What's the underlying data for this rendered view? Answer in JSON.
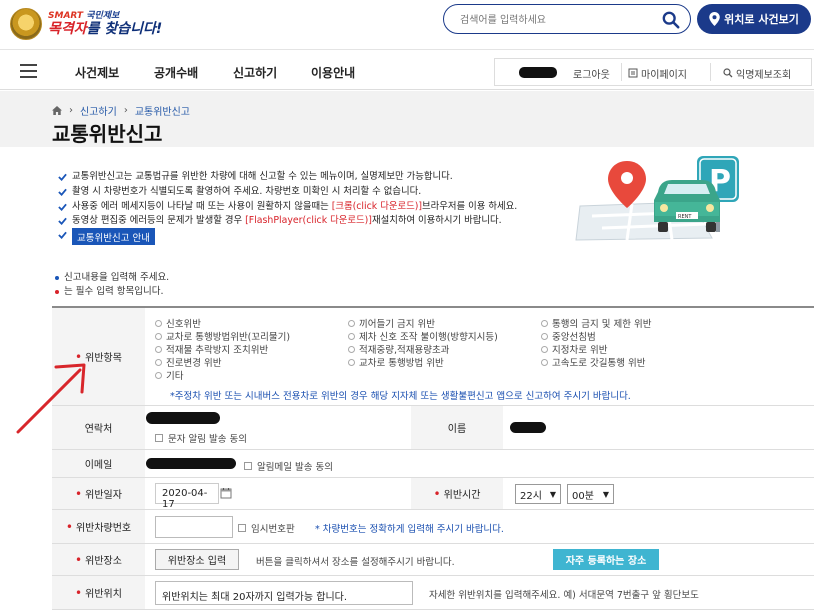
{
  "header": {
    "logo_small": "SMART 국민제보",
    "logo_small_brand": "SMART",
    "logo_small_rest": "국민제보",
    "logo_big_red": "목격자",
    "logo_big_rest": "를 찾습니다!",
    "search_placeholder": "검색어를 입력하세요",
    "location_button": "위치로 사건보기"
  },
  "nav": {
    "items": [
      "사건제보",
      "공개수배",
      "신고하기",
      "이용안내"
    ],
    "logout": "로그아웃",
    "mypage": "마이페이지",
    "anon": "익명제보조회"
  },
  "breadcrumb": {
    "items": [
      "신고하기",
      "교통위반신고"
    ]
  },
  "page_title": "교통위반신고",
  "intro": {
    "lines": [
      "교통위반신고는 교통법규를 위반한 차량에 대해 신고할 수 있는 메뉴이며, 실명제보만 가능합니다.",
      "촬영 시 차량번호가 식별되도록 촬영하여 주세요. 차량번호 미확인 시 처리할 수 없습니다."
    ],
    "line3_a": "사용중 에러 메세지등이 나타날 때 또는 사용이 원활하지 않을때는 ",
    "line3_red": "[크롬(click 다운로드)]",
    "line3_b": "브라우저를 이용 하세요.",
    "line4_a": "동영상 편집중 에러등의 문제가 발생할 경우 ",
    "line4_red": "[FlashPlayer(click 다운로드)]",
    "line4_b": "재설치하여 이용하시기 바랍니다.",
    "guide_button": "교통위반신고 안내"
  },
  "notes": {
    "enter": "신고내용을 입력해 주세요.",
    "required": "는 필수 입력 항목입니다."
  },
  "form": {
    "violation_label": "위반항목",
    "violations": [
      "신호위반",
      "끼어들기 금지 위반",
      "통행의 금지 및 제한 위반",
      "교차로 통행방법위반(꼬리물기)",
      "제차 신호 조작 불이행(방향지시등)",
      "중앙선침범",
      "적재물 추락방지 조치위반",
      "적재중량,적재용량초과",
      "지정차로 위반",
      "진로변경 위반",
      "교차로 통행방법 위반",
      "고속도로 갓길통행 위반",
      "기타"
    ],
    "violation_note": "*주정차 위반 또는 시내버스 전용차로 위반의 경우 해당 지자체 또는 생활불편신고 앱으로 신고하여 주시기 바랍니다.",
    "contact_label": "연락처",
    "sms_consent": "문자 알림 발송 동의",
    "name_label": "이름",
    "email_label": "이메일",
    "mail_consent": "알림메일 발송 동의",
    "date_label": "위반일자",
    "date_value": "2020-04-17",
    "time_label": "위반시간",
    "hour_value": "22시",
    "minute_value": "00분",
    "plate_label": "위반차량번호",
    "temp_plate": "임시번호판",
    "plate_note": "* 차량번호는 정확하게 입력해 주시기 바랍니다.",
    "place_label": "위반장소",
    "place_button": "위반장소 입력",
    "place_hint": "버튼을 클릭하셔서 장소를 설정해주시기 바랍니다.",
    "favorite_button": "자주 등록하는 장소",
    "position_label": "위반위치",
    "position_value": "위반위치는 최대 20자까지 입력가능 합니다.",
    "position_hint": "자세한 위반위치를 입력해주세요. 예) 서대문역 7번출구 앞 횡단보도"
  },
  "colors": {
    "brand": "#1b3a8a",
    "required": "#d8232a",
    "favorite": "#3fb5d1"
  }
}
